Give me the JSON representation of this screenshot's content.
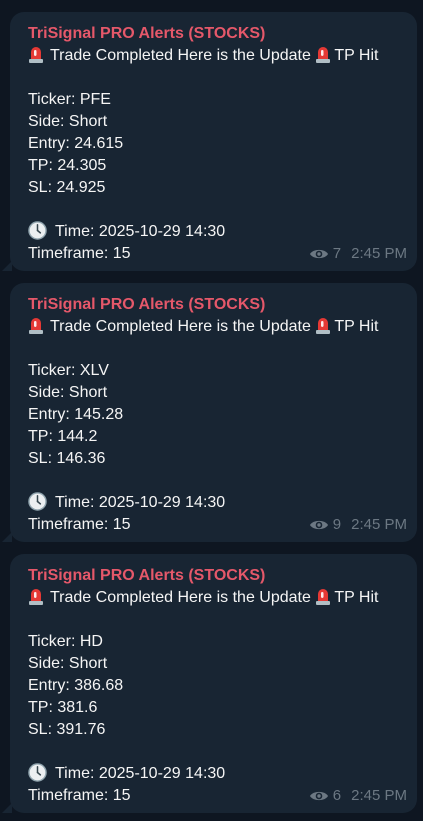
{
  "messages": [
    {
      "sender": "TriSignal PRO Alerts (STOCKS)",
      "headline": "Trade Completed Here is the Update",
      "tag": "TP Hit",
      "ticker": "Ticker: PFE",
      "side": "Side: Short",
      "entry": "Entry: 24.615",
      "tp": "TP: 24.305",
      "sl": "SL: 24.925",
      "time": "Time: 2025-10-29 14:30",
      "timeframe": "Timeframe: 15",
      "views": "7",
      "timestamp": "2:45 PM"
    },
    {
      "sender": "TriSignal PRO Alerts (STOCKS)",
      "headline": "Trade Completed Here is the Update",
      "tag": "TP Hit",
      "ticker": "Ticker: XLV",
      "side": "Side: Short",
      "entry": "Entry: 145.28",
      "tp": "TP: 144.2",
      "sl": "SL: 146.36",
      "time": "Time: 2025-10-29 14:30",
      "timeframe": "Timeframe: 15",
      "views": "9",
      "timestamp": "2:45 PM"
    },
    {
      "sender": "TriSignal PRO Alerts (STOCKS)",
      "headline": "Trade Completed Here is the Update",
      "tag": "TP Hit",
      "ticker": "Ticker: HD",
      "side": "Side: Short",
      "entry": "Entry: 386.68",
      "tp": "TP: 381.6",
      "sl": "SL: 391.76",
      "time": "Time: 2025-10-29 14:30",
      "timeframe": "Timeframe: 15",
      "views": "6",
      "timestamp": "2:45 PM"
    }
  ],
  "icons": {
    "alert": "police-siren-icon",
    "time": "clock-icon",
    "views": "eye-icon"
  },
  "colors": {
    "background": "#0e1621",
    "bubble": "#182533",
    "sender": "#e5586a",
    "text": "#f5f5f5",
    "meta": "#6c7883"
  }
}
